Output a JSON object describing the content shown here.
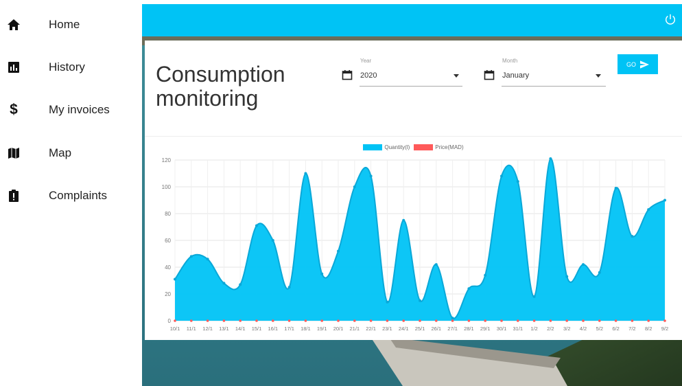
{
  "sidebar": {
    "items": [
      {
        "label": "Home",
        "icon": "home-icon"
      },
      {
        "label": "History",
        "icon": "bar-chart-icon"
      },
      {
        "label": "My invoices",
        "icon": "dollar-icon"
      },
      {
        "label": "Map",
        "icon": "map-icon"
      },
      {
        "label": "Complaints",
        "icon": "clipboard-alert-icon"
      }
    ]
  },
  "header": {
    "accent": "#00c3f5",
    "power_icon": "power-icon"
  },
  "card": {
    "title_line1": "Consumption",
    "title_line2": "monitoring",
    "year": {
      "label": "Year",
      "value": "2020"
    },
    "month": {
      "label": "Month",
      "value": "January"
    },
    "go_label": "GO"
  },
  "chart_data": {
    "type": "area",
    "legend": [
      {
        "name": "Quantity(l)",
        "color": "#00c3f5"
      },
      {
        "name": "Price(MAD)",
        "color": "#ff5a5a"
      }
    ],
    "categories": [
      "10/1",
      "11/1",
      "12/1",
      "13/1",
      "14/1",
      "15/1",
      "16/1",
      "17/1",
      "18/1",
      "19/1",
      "20/1",
      "21/1",
      "22/1",
      "23/1",
      "24/1",
      "25/1",
      "26/1",
      "27/1",
      "28/1",
      "29/1",
      "30/1",
      "31/1",
      "1/2",
      "2/2",
      "3/2",
      "4/2",
      "5/2",
      "6/2",
      "7/2",
      "8/2",
      "9/2"
    ],
    "series": [
      {
        "name": "Quantity(l)",
        "values": [
          31,
          48,
          46,
          28,
          27,
          71,
          60,
          25,
          110,
          35,
          52,
          100,
          108,
          14,
          75,
          15,
          42,
          2,
          24,
          34,
          108,
          104,
          18,
          121,
          33,
          42,
          36,
          99,
          63,
          83,
          90
        ]
      },
      {
        "name": "Price(MAD)",
        "values": [
          0,
          0,
          0,
          0,
          0,
          0,
          0,
          0,
          0,
          0,
          0,
          0,
          0,
          0,
          0,
          0,
          0,
          0,
          0,
          0,
          0,
          0,
          0,
          0,
          0,
          0,
          0,
          0,
          0,
          0,
          0
        ]
      }
    ],
    "ylim": [
      0,
      120
    ],
    "yticks": [
      0,
      20,
      40,
      60,
      80,
      100,
      120
    ],
    "grid": true,
    "legend_position": "top"
  }
}
